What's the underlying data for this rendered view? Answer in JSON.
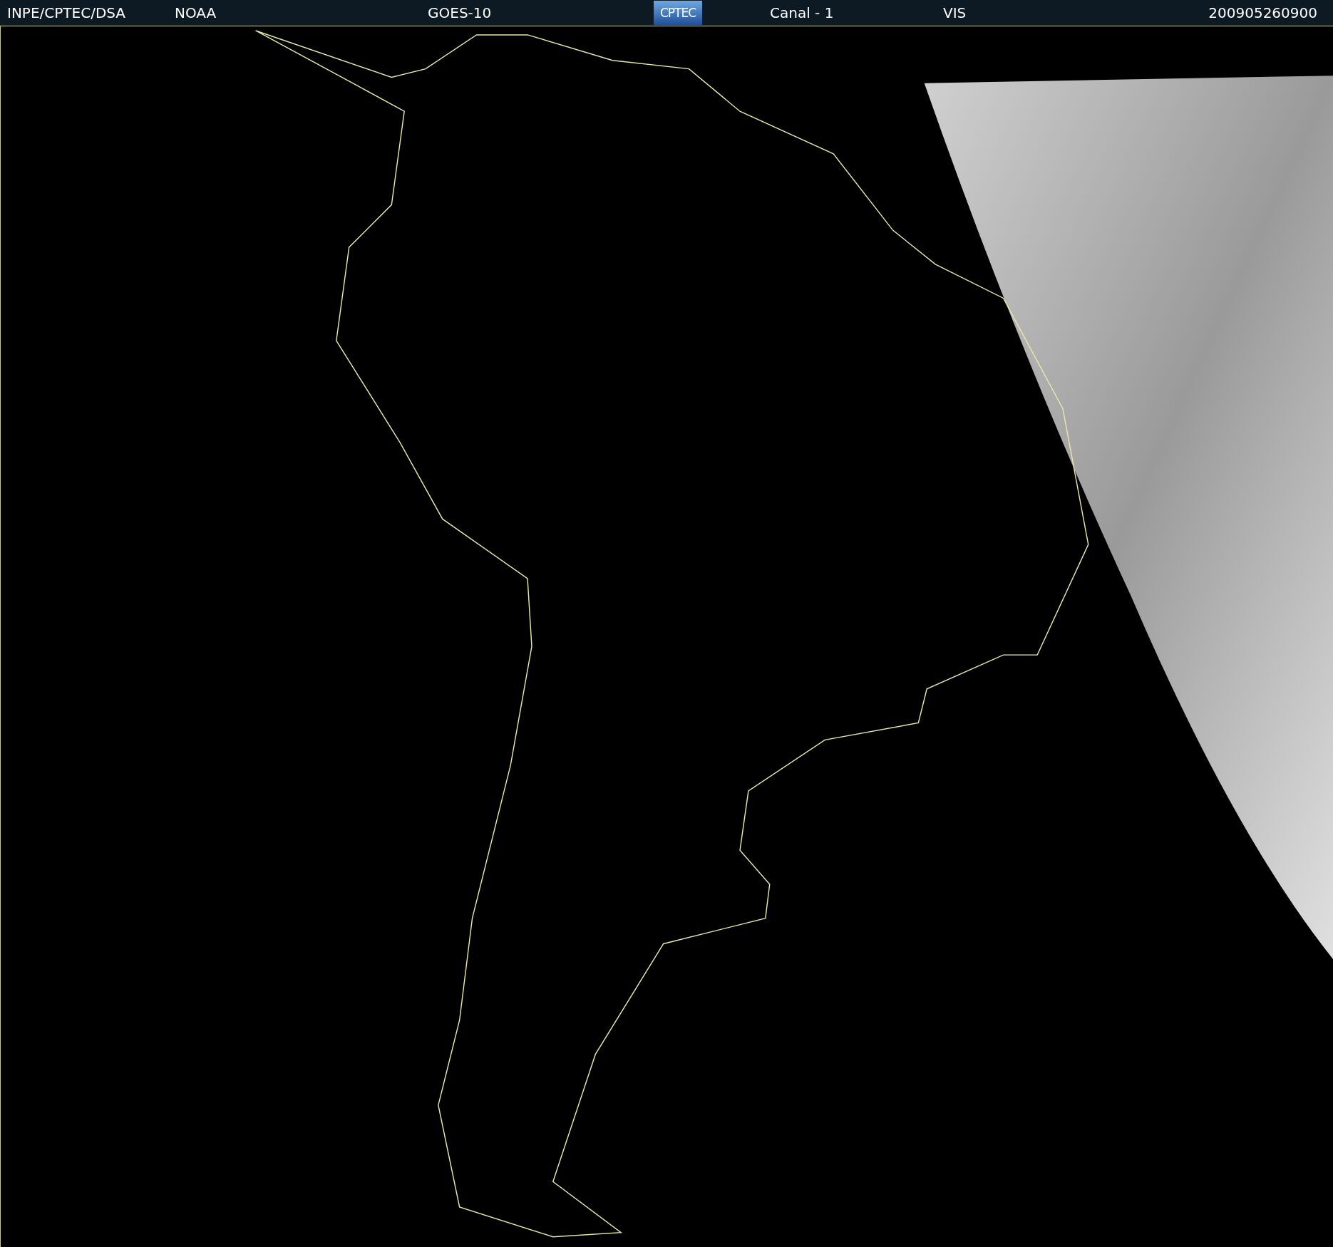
{
  "header": {
    "source": "INPE/CPTEC/DSA",
    "agency": "NOAA",
    "satellite": "GOES-10",
    "logo": "CPTEC",
    "channel": "Canal - 1",
    "band": "VIS",
    "timestamp": "200905260900"
  }
}
